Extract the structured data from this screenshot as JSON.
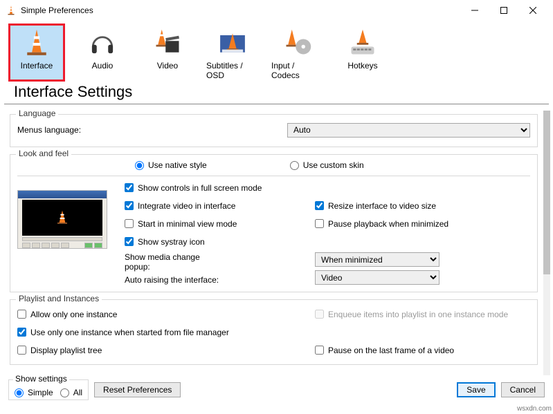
{
  "window": {
    "title": "Simple Preferences"
  },
  "tabs": [
    {
      "label": "Interface"
    },
    {
      "label": "Audio"
    },
    {
      "label": "Video"
    },
    {
      "label": "Subtitles / OSD"
    },
    {
      "label": "Input / Codecs"
    },
    {
      "label": "Hotkeys"
    }
  ],
  "heading": "Interface Settings",
  "groups": {
    "language": {
      "legend": "Language",
      "menus_label": "Menus language:",
      "menus_value": "Auto"
    },
    "lookfeel": {
      "legend": "Look and feel",
      "radio_native": "Use native style",
      "radio_custom": "Use custom skin",
      "chk_fullscreen": "Show controls in full screen mode",
      "chk_integrate": "Integrate video in interface",
      "chk_minimal": "Start in minimal view mode",
      "chk_systray": "Show systray icon",
      "chk_resize": "Resize interface to video size",
      "chk_pause_min": "Pause playback when minimized",
      "popup_label": "Show media change popup:",
      "popup_value": "When minimized",
      "autoraise_label": "Auto raising the interface:",
      "autoraise_value": "Video"
    },
    "playlist": {
      "legend": "Playlist and Instances",
      "chk_allowone": "Allow only one instance",
      "chk_fileone": "Use only one instance when started from file manager",
      "chk_displaytree": "Display playlist tree",
      "chk_enqueue": "Enqueue items into playlist in one instance mode",
      "chk_pauselast": "Pause on the last frame of a video"
    }
  },
  "footer": {
    "show_settings_legend": "Show settings",
    "radio_simple": "Simple",
    "radio_all": "All",
    "reset": "Reset Preferences",
    "save": "Save",
    "cancel": "Cancel"
  },
  "watermark": "wsxdn.com"
}
